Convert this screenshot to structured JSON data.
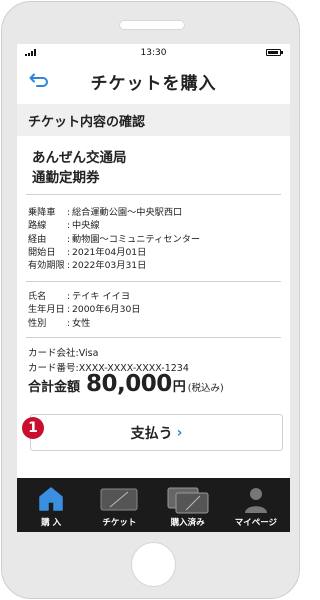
{
  "status_bar": {
    "time": "13:30"
  },
  "header": {
    "title": "チケットを購入"
  },
  "section": {
    "title": "チケット内容の確認"
  },
  "ticket": {
    "operator": "あんぜん交通局",
    "type": "通勤定期券"
  },
  "route_details": [
    {
      "label": "乗降車",
      "value": "総合運動公園～中央駅西口"
    },
    {
      "label": "路線",
      "value": "中央線"
    },
    {
      "label": "経由",
      "value": "動物園～コミュニティセンター"
    },
    {
      "label": "開始日",
      "value": "2021年04月01日"
    },
    {
      "label": "有効期限",
      "value": "2022年03月31日"
    }
  ],
  "person_details": [
    {
      "label": "氏名",
      "value": "テイキ イイヨ"
    },
    {
      "label": "生年月日",
      "value": "2000年6月30日"
    },
    {
      "label": "性別",
      "value": "女性"
    }
  ],
  "payment": {
    "card_company": "カード会社:Visa",
    "card_number": "カード番号:XXXX-XXXX-XXXX-1234",
    "total_label": "合計金額",
    "total_amount": "80,000",
    "currency": "円",
    "tax_note": "(税込み)"
  },
  "pay_button": {
    "label": "支払う",
    "chevron": "›"
  },
  "step_badge": "1",
  "tabs": [
    {
      "label": "購 入",
      "icon": "home-icon"
    },
    {
      "label": "チケット",
      "icon": "ticket-icon"
    },
    {
      "label": "購入済み",
      "icon": "purchased-tickets-icon"
    },
    {
      "label": "マイページ",
      "icon": "user-icon"
    }
  ],
  "colors": {
    "accent": "#2f86d8",
    "badge": "#c8102e",
    "tab_bar": "#1b1b1b"
  }
}
